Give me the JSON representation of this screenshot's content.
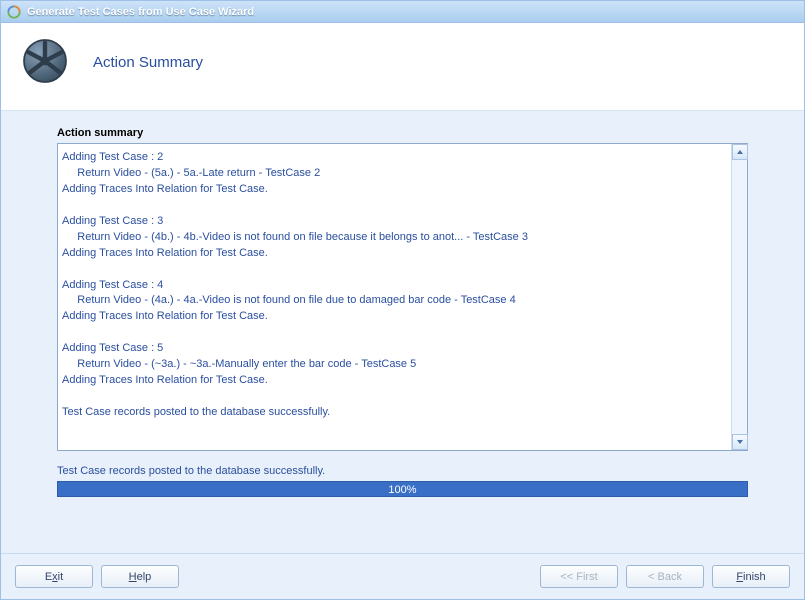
{
  "window": {
    "title": "Generate Test Cases from Use Case Wizard"
  },
  "header": {
    "title": "Action Summary"
  },
  "section": {
    "label": "Action summary"
  },
  "log_lines": [
    "Adding Test Case : 2",
    "     Return Video - (5a.) - 5a.-Late return - TestCase 2",
    "Adding Traces Into Relation for Test Case.",
    "",
    "Adding Test Case : 3",
    "     Return Video - (4b.) - 4b.-Video is not found on file because it belongs to anot... - TestCase 3",
    "Adding Traces Into Relation for Test Case.",
    "",
    "Adding Test Case : 4",
    "     Return Video - (4a.) - 4a.-Video is not found on file due to damaged bar code - TestCase 4",
    "Adding Traces Into Relation for Test Case.",
    "",
    "Adding Test Case : 5",
    "     Return Video - (~3a.) - ~3a.-Manually enter the bar code - TestCase 5",
    "Adding Traces Into Relation for Test Case.",
    "",
    "Test Case records posted to the database successfully."
  ],
  "status": {
    "message": "Test Case records posted to the database successfully."
  },
  "progress": {
    "text": "100%",
    "percent": 100
  },
  "buttons": {
    "exit_pre": "E",
    "exit_ul": "x",
    "exit_post": "it",
    "help_pre": "",
    "help_ul": "H",
    "help_post": "elp",
    "first": "<< First",
    "back": "< Back",
    "finish_pre": "",
    "finish_ul": "F",
    "finish_post": "inish"
  },
  "colors": {
    "accent": "#2a4f9e",
    "progress_fill": "#3a6fc7"
  }
}
